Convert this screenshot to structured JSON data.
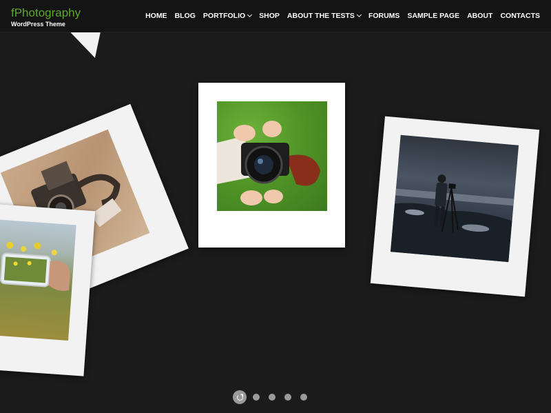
{
  "header": {
    "site_title": "fPhotography",
    "site_tagline": "WordPress Theme",
    "nav": [
      {
        "label": "HOME",
        "has_submenu": false
      },
      {
        "label": "BLOG",
        "has_submenu": false
      },
      {
        "label": "PORTFOLIO",
        "has_submenu": true
      },
      {
        "label": "SHOP",
        "has_submenu": false
      },
      {
        "label": "ABOUT THE TESTS",
        "has_submenu": true
      },
      {
        "label": "FORUMS",
        "has_submenu": false
      },
      {
        "label": "SAMPLE PAGE",
        "has_submenu": false
      },
      {
        "label": "ABOUT",
        "has_submenu": false
      },
      {
        "label": "CONTACTS",
        "has_submenu": false
      }
    ]
  },
  "colors": {
    "background": "#1b1b1b",
    "header_bg": "#141414",
    "brand_green": "#5fa82f",
    "polaroid_frame": "#f2f2f2",
    "dot": "#9a9a9a"
  },
  "slider": {
    "slide_count": 5,
    "active_index": 0,
    "active_icon": "reload-icon"
  },
  "photos": [
    {
      "subject": "vintage folding camera"
    },
    {
      "subject": "person with camera lying on grass"
    },
    {
      "subject": "photographer with tripod on rocky shore"
    },
    {
      "subject": "phone photographing yellow flowers"
    }
  ]
}
